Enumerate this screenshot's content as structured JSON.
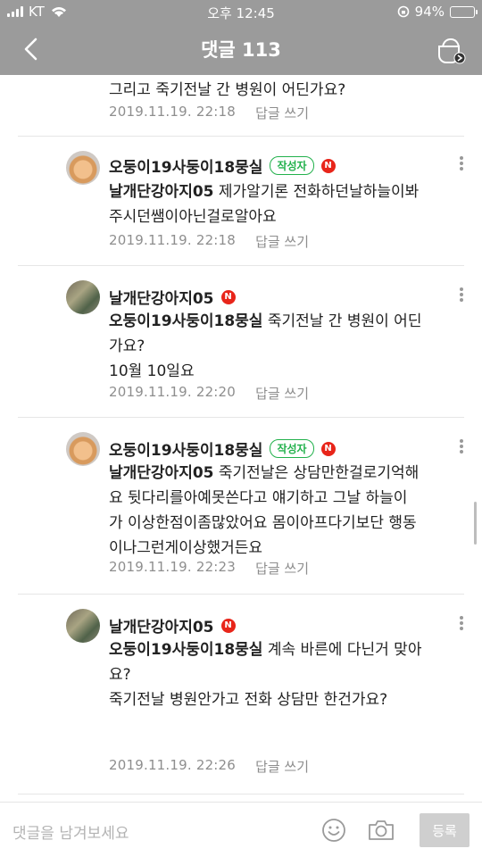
{
  "status_bar": {
    "carrier": "KT",
    "time": "오후 12:45",
    "battery": "94%",
    "battery_level": 0.94
  },
  "header": {
    "title": "댓글 113"
  },
  "top_fragment": {
    "text": "그리고 죽기전날 간 병원이 어딘가요?",
    "date": "2019.11.19. 22:18",
    "reply": "답글 쓰기"
  },
  "comments": [
    {
      "author": "오둥이19사둥이18뭉실",
      "author_badge": "작성자",
      "new_badge": "N",
      "mention": "날개단강아지05",
      "lines": [
        "제가알기론 전화하던날하늘이봐",
        "주시던쌤이아닌걸로알아요"
      ],
      "date": "2019.11.19. 22:18",
      "reply": "답글 쓰기"
    },
    {
      "author": "날개단강아지05",
      "new_badge": "N",
      "mention": "오둥이19사둥이18뭉실",
      "lines": [
        "죽기전날 간 병원이 어딘",
        "가요?",
        "10월 10일요"
      ],
      "date": "2019.11.19. 22:20",
      "reply": "답글 쓰기"
    },
    {
      "author": "오둥이19사둥이18뭉실",
      "author_badge": "작성자",
      "new_badge": "N",
      "mention": "날개단강아지05",
      "lines": [
        "죽기전날은 상담만한걸로기억해",
        "요   뒷다리를아예못쓴다고 얘기하고 그날 하늘이",
        "가 이상한점이좀많았어요  몸이아프다기보단 행동",
        "이나그런게이상했거든요"
      ],
      "date": "2019.11.19. 22:23",
      "reply": "답글 쓰기"
    },
    {
      "author": "날개단강아지05",
      "new_badge": "N",
      "mention": "오둥이19사둥이18뭉실",
      "lines": [
        "계속 바른에 다닌거 맞아",
        "요?",
        "죽기전날 병원안가고 전화 상담만  한건가요?"
      ],
      "date": "2019.11.19. 22:26",
      "reply": "답글 쓰기"
    }
  ],
  "footer": {
    "placeholder": "댓글을 남겨보세요",
    "submit": "등록"
  }
}
